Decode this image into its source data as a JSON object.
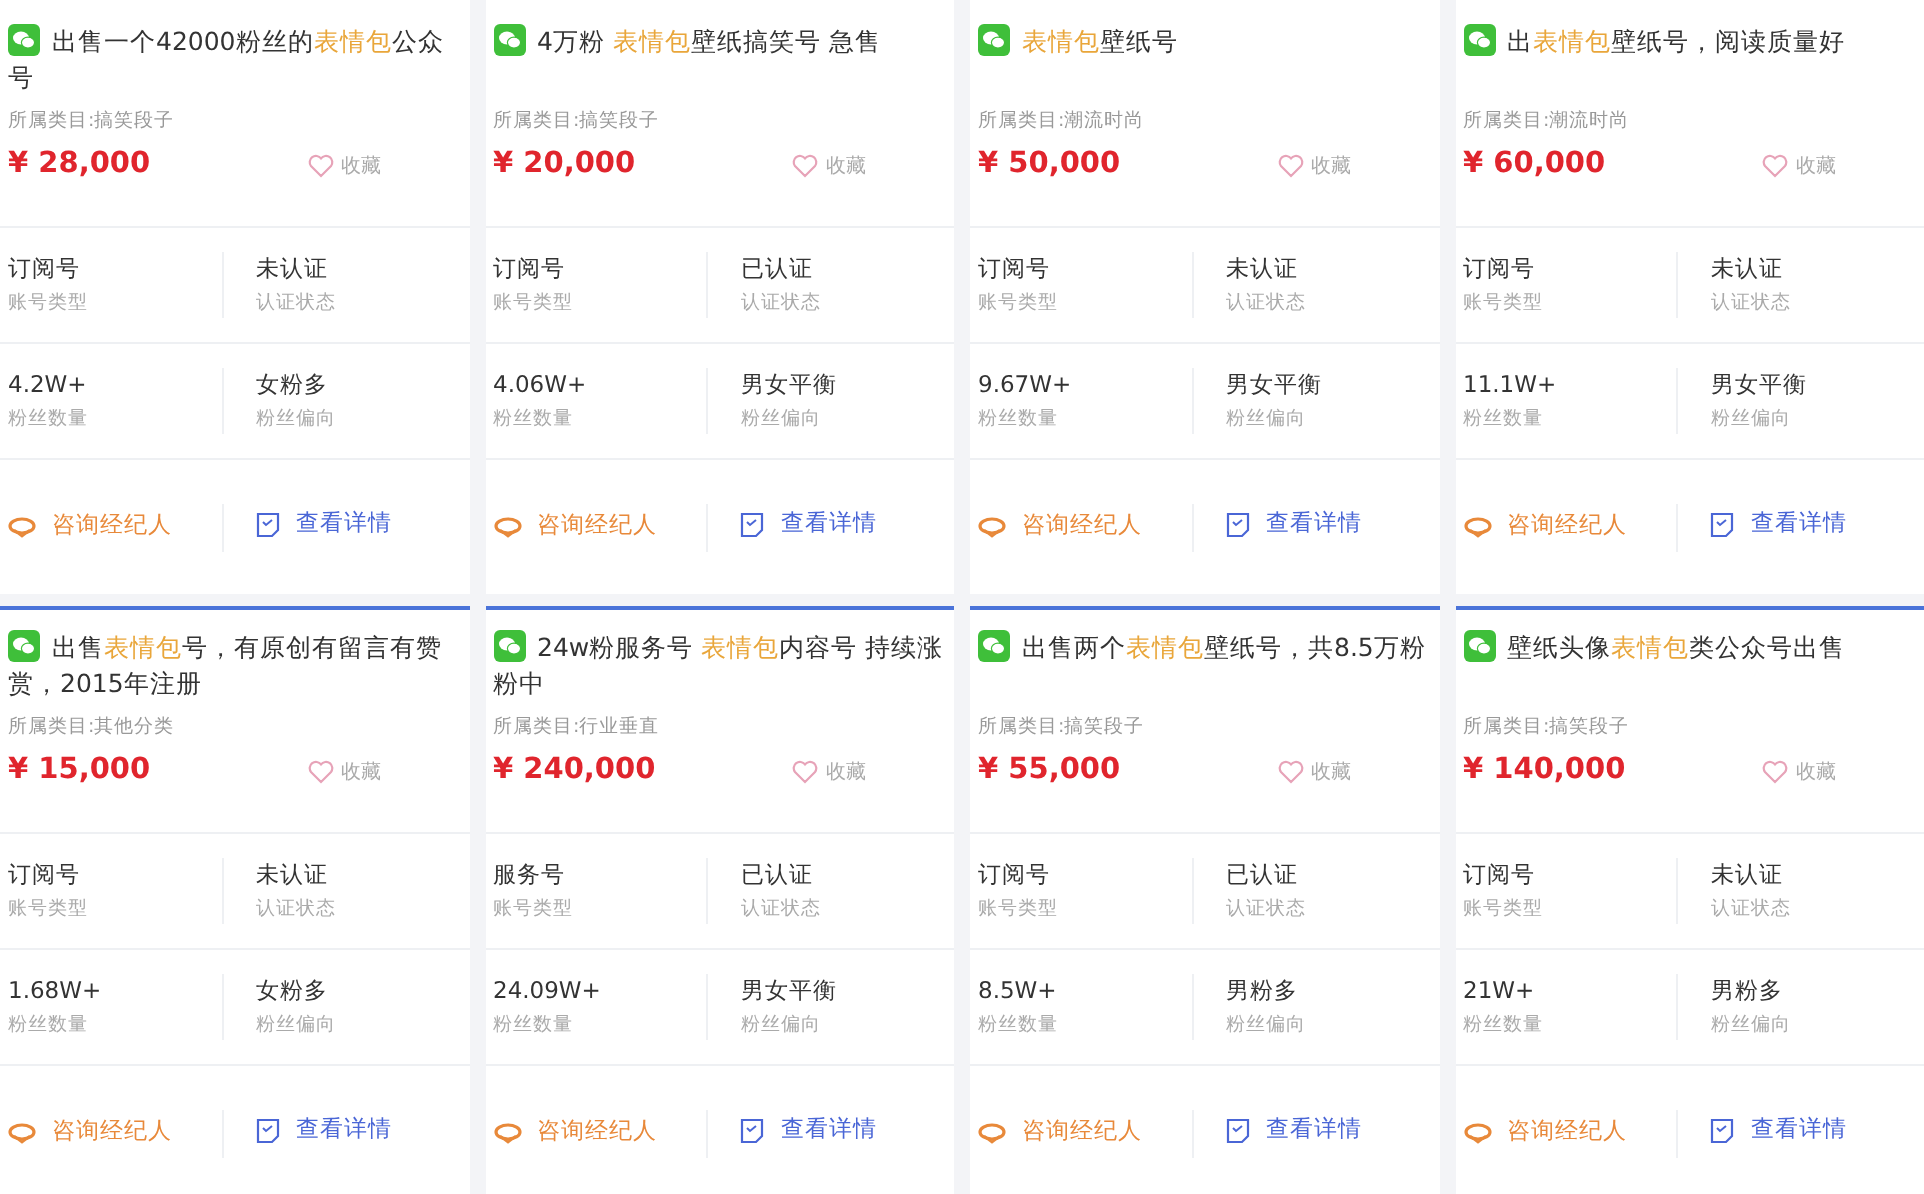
{
  "listings": [
    {
      "highlighted": false,
      "title": [
        {
          "text": "出售一个42000粉丝的",
          "keyword": false
        },
        {
          "text": "表情包",
          "keyword": true
        },
        {
          "text": "公众号",
          "keyword": false
        }
      ],
      "category": "所属类目:搞笑段子",
      "price": "¥ 28,000",
      "favorite": "收藏",
      "stats": [
        {
          "value": "订阅号",
          "label": "账号类型"
        },
        {
          "value": "未认证",
          "label": "认证状态"
        },
        {
          "value": "4.2W+",
          "label": "粉丝数量"
        },
        {
          "value": "女粉多",
          "label": "粉丝偏向"
        }
      ],
      "consult": "咨询经纪人",
      "details": "查看详情"
    },
    {
      "highlighted": false,
      "title": [
        {
          "text": "4万粉 ",
          "keyword": false
        },
        {
          "text": "表情包",
          "keyword": true
        },
        {
          "text": "壁纸搞笑号 急售",
          "keyword": false
        }
      ],
      "category": "所属类目:搞笑段子",
      "price": "¥ 20,000",
      "favorite": "收藏",
      "stats": [
        {
          "value": "订阅号",
          "label": "账号类型"
        },
        {
          "value": "已认证",
          "label": "认证状态"
        },
        {
          "value": "4.06W+",
          "label": "粉丝数量"
        },
        {
          "value": "男女平衡",
          "label": "粉丝偏向"
        }
      ],
      "consult": "咨询经纪人",
      "details": "查看详情"
    },
    {
      "highlighted": false,
      "title": [
        {
          "text": "表情包",
          "keyword": true
        },
        {
          "text": "壁纸号",
          "keyword": false
        }
      ],
      "category": "所属类目:潮流时尚",
      "price": "¥ 50,000",
      "favorite": "收藏",
      "stats": [
        {
          "value": "订阅号",
          "label": "账号类型"
        },
        {
          "value": "未认证",
          "label": "认证状态"
        },
        {
          "value": "9.67W+",
          "label": "粉丝数量"
        },
        {
          "value": "男女平衡",
          "label": "粉丝偏向"
        }
      ],
      "consult": "咨询经纪人",
      "details": "查看详情"
    },
    {
      "highlighted": false,
      "title": [
        {
          "text": "出",
          "keyword": false
        },
        {
          "text": "表情包",
          "keyword": true
        },
        {
          "text": "壁纸号，阅读质量好",
          "keyword": false
        }
      ],
      "category": "所属类目:潮流时尚",
      "price": "¥ 60,000",
      "favorite": "收藏",
      "stats": [
        {
          "value": "订阅号",
          "label": "账号类型"
        },
        {
          "value": "未认证",
          "label": "认证状态"
        },
        {
          "value": "11.1W+",
          "label": "粉丝数量"
        },
        {
          "value": "男女平衡",
          "label": "粉丝偏向"
        }
      ],
      "consult": "咨询经纪人",
      "details": "查看详情"
    },
    {
      "highlighted": true,
      "title": [
        {
          "text": "出售",
          "keyword": false
        },
        {
          "text": "表情包",
          "keyword": true
        },
        {
          "text": "号，有原创有留言有赞赏，2015年注册",
          "keyword": false
        }
      ],
      "category": "所属类目:其他分类",
      "price": "¥ 15,000",
      "favorite": "收藏",
      "stats": [
        {
          "value": "订阅号",
          "label": "账号类型"
        },
        {
          "value": "未认证",
          "label": "认证状态"
        },
        {
          "value": "1.68W+",
          "label": "粉丝数量"
        },
        {
          "value": "女粉多",
          "label": "粉丝偏向"
        }
      ],
      "consult": "咨询经纪人",
      "details": "查看详情"
    },
    {
      "highlighted": true,
      "title": [
        {
          "text": "24w粉服务号 ",
          "keyword": false
        },
        {
          "text": "表情包",
          "keyword": true
        },
        {
          "text": "内容号 持续涨粉中",
          "keyword": false
        }
      ],
      "category": "所属类目:行业垂直",
      "price": "¥ 240,000",
      "favorite": "收藏",
      "stats": [
        {
          "value": "服务号",
          "label": "账号类型"
        },
        {
          "value": "已认证",
          "label": "认证状态"
        },
        {
          "value": "24.09W+",
          "label": "粉丝数量"
        },
        {
          "value": "男女平衡",
          "label": "粉丝偏向"
        }
      ],
      "consult": "咨询经纪人",
      "details": "查看详情"
    },
    {
      "highlighted": true,
      "title": [
        {
          "text": "出售两个",
          "keyword": false
        },
        {
          "text": "表情包",
          "keyword": true
        },
        {
          "text": "壁纸号，共8.5万粉",
          "keyword": false
        }
      ],
      "category": "所属类目:搞笑段子",
      "price": "¥ 55,000",
      "favorite": "收藏",
      "stats": [
        {
          "value": "订阅号",
          "label": "账号类型"
        },
        {
          "value": "已认证",
          "label": "认证状态"
        },
        {
          "value": "8.5W+",
          "label": "粉丝数量"
        },
        {
          "value": "男粉多",
          "label": "粉丝偏向"
        }
      ],
      "consult": "咨询经纪人",
      "details": "查看详情"
    },
    {
      "highlighted": true,
      "title": [
        {
          "text": "壁纸头像",
          "keyword": false
        },
        {
          "text": "表情包",
          "keyword": true
        },
        {
          "text": "类公众号出售",
          "keyword": false
        }
      ],
      "category": "所属类目:搞笑段子",
      "price": "¥ 140,000",
      "favorite": "收藏",
      "stats": [
        {
          "value": "订阅号",
          "label": "账号类型"
        },
        {
          "value": "未认证",
          "label": "认证状态"
        },
        {
          "value": "21W+",
          "label": "粉丝数量"
        },
        {
          "value": "男粉多",
          "label": "粉丝偏向"
        }
      ],
      "consult": "咨询经纪人",
      "details": "查看详情"
    }
  ]
}
